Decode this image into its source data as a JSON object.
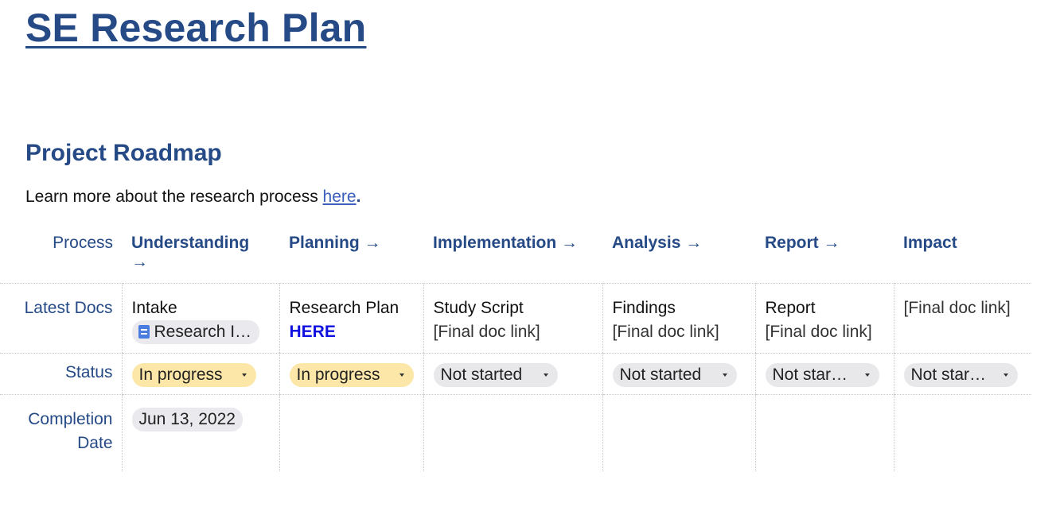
{
  "title": "SE Research Plan",
  "section_heading": "Project Roadmap",
  "intro": {
    "text": "Learn more about the research process ",
    "link": "here",
    "trailing": "."
  },
  "table": {
    "row_labels": {
      "process": "Process",
      "latest_docs": "Latest Docs",
      "status": "Status",
      "completion": "Completion Date"
    },
    "columns": [
      {
        "header": "Understanding →",
        "doc_name": "Intake",
        "doc_chip": "Research I…",
        "doc_chip_icon": "google-doc-icon",
        "status": "In progress",
        "completion_date": "Jun 13, 2022"
      },
      {
        "header": "Planning →",
        "doc_name": "Research Plan",
        "doc_link": "HERE",
        "status": "In progress"
      },
      {
        "header": "Implementation →",
        "doc_name": "Study Script",
        "doc_link": "[Final doc link]",
        "status": "Not started"
      },
      {
        "header": "Analysis →",
        "doc_name": "Findings",
        "doc_link": "[Final doc link]",
        "status": "Not started"
      },
      {
        "header": "Report →",
        "doc_name": "Report",
        "doc_link": "[Final doc link]",
        "status": "Not star…"
      },
      {
        "header": "Impact",
        "doc_name": "[Final doc link]",
        "status": "Not star…"
      }
    ]
  },
  "colors": {
    "heading": "#254a86",
    "link": "#3b5fbd",
    "here_link": "#1010e0",
    "in_progress": "#fde7a8",
    "not_started": "#e8e8ea"
  }
}
